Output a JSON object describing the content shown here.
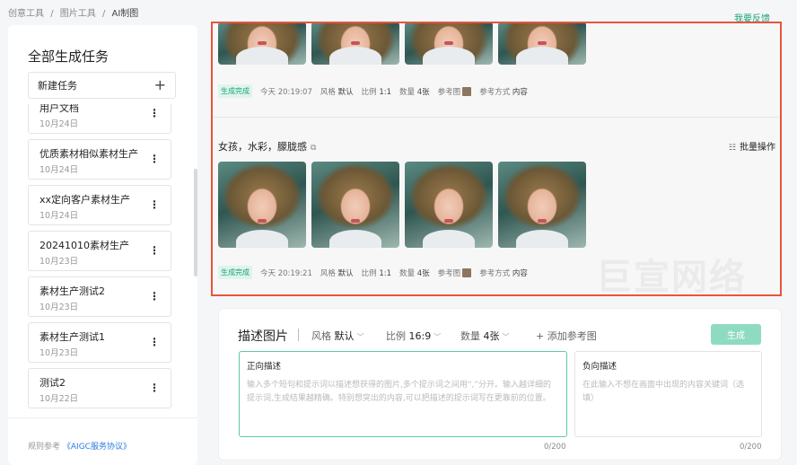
{
  "breadcrumb": [
    "创意工具",
    "/",
    "图片工具",
    "/",
    "AI制图"
  ],
  "feedback": "我要反馈",
  "sidebar": {
    "title": "全部生成任务",
    "new_task": "新建任务",
    "tasks": [
      {
        "name": "用户文档",
        "date": "10月24日"
      },
      {
        "name": "优质素材相似素材生产",
        "date": "10月24日"
      },
      {
        "name": "xx定向客户素材生产",
        "date": "10月24日"
      },
      {
        "name": "20241010素材生产",
        "date": "10月23日"
      },
      {
        "name": "素材生产测试2",
        "date": "10月23日"
      },
      {
        "name": "素材生产测试1",
        "date": "10月23日"
      },
      {
        "name": "测试2",
        "date": "10月22日"
      }
    ],
    "agreement_prefix": "规则参考",
    "agreement_link": "《AIGC服务协议》"
  },
  "results": {
    "groups": [
      {
        "meta": {
          "status": "生成完成",
          "time": "今天 20:19:07",
          "style_label": "风格",
          "style": "默认",
          "ratio_label": "比例",
          "ratio": "1:1",
          "count_label": "数量",
          "count": "4张",
          "ref_label": "参考图",
          "mode_label": "参考方式",
          "mode": "内容"
        }
      },
      {
        "prompt": "女孩，水彩，朦胧感",
        "batch": "批量操作",
        "meta": {
          "status": "生成完成",
          "time": "今天 20:19:21",
          "style_label": "风格",
          "style": "默认",
          "ratio_label": "比例",
          "ratio": "1:1",
          "count_label": "数量",
          "count": "4张",
          "ref_label": "参考图",
          "mode_label": "参考方式",
          "mode": "内容"
        }
      }
    ],
    "watermark": "巨宣网络"
  },
  "composer": {
    "title": "描述图片",
    "style_label": "风格",
    "style": "默认",
    "ratio_label": "比例",
    "ratio": "16:9",
    "count_label": "数量",
    "count": "4张",
    "add_ref": "添加参考图",
    "generate": "生成",
    "positive": {
      "label": "正向描述",
      "placeholder": "输入多个短句和提示词以描述想获得的图片,多个提示词之间用“,”分开。输入越详细的提示词,生成结果越精确。特别想突出的内容,可以把描述的提示词写在更靠前的位置。",
      "count": "0/200"
    },
    "negative": {
      "label": "负向描述",
      "placeholder": "在此输入不想在画面中出现的内容关键词（选填）",
      "count": "0/200"
    }
  }
}
